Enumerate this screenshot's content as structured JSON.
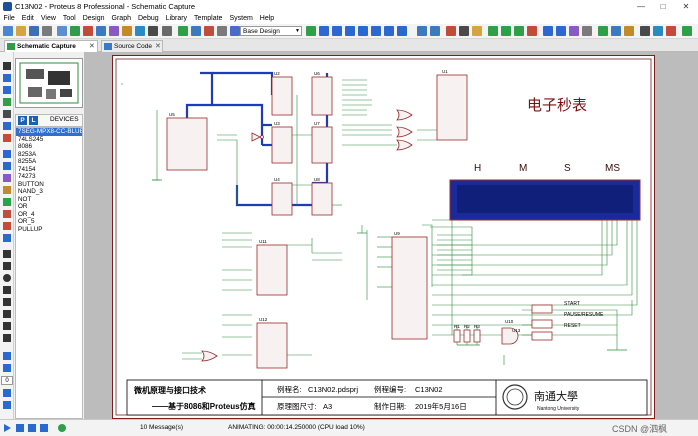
{
  "window": {
    "title": "C13N02 - Proteus 8 Professional - Schematic Capture",
    "minimize": "—",
    "maximize": "□",
    "close": "✕"
  },
  "menu": [
    "File",
    "Edit",
    "View",
    "Tool",
    "Design",
    "Graph",
    "Debug",
    "Library",
    "Template",
    "System",
    "Help"
  ],
  "toolbar": {
    "design_select": "Base Design"
  },
  "tabs": [
    {
      "label": "Schematic Capture",
      "close": "✕"
    },
    {
      "label": "Source Code",
      "close": "✕"
    }
  ],
  "devices": {
    "header": "DEVICES",
    "p_label": "P",
    "l_label": "L",
    "items": [
      "7SEG-MPX8-CC-BLUE",
      "74LS245",
      "8086",
      "8253A",
      "8255A",
      "74154",
      "74273",
      "BUTTON",
      "NAND_3",
      "NOT",
      "OR",
      "OR_4",
      "OR_5",
      "PULLUP"
    ],
    "selected": 0
  },
  "schematic": {
    "title": "电子秒表",
    "display_labels": [
      "H",
      "M",
      "S",
      "MS"
    ],
    "buttons": [
      "START",
      "PAUSE/RESUME",
      "RESET"
    ],
    "components": [
      "U1",
      "U2",
      "U3",
      "U4",
      "U5",
      "U6",
      "U7",
      "U8",
      "U9",
      "U10",
      "U11",
      "U12",
      "U13",
      "R1",
      "R2",
      "R3"
    ],
    "titleblock": {
      "course": "微机原理与接口技术",
      "subtitle": "——基于8086和Proteus仿真",
      "project_label": "例程名:",
      "project": "C13N02.pdsprj",
      "number_label": "例程编号:",
      "number": "C13N02",
      "size_label": "原理图尺寸:",
      "size": "A3",
      "date_label": "制作日期:",
      "date": "2019年5月16日",
      "university_cn": "南通大學",
      "university_en": "Nantong University"
    }
  },
  "status": {
    "messages": "10 Message(s)",
    "animating": "ANIMATING: 00:00:14.250000 (CPU load 10%)",
    "watermark": "CSDN @泗枫"
  },
  "colors": {
    "wire": "#2d8c3c",
    "bus": "#1f3bb8",
    "component": "#9b2a2a",
    "title": "#7a1010",
    "display": "#1a2a9a"
  }
}
